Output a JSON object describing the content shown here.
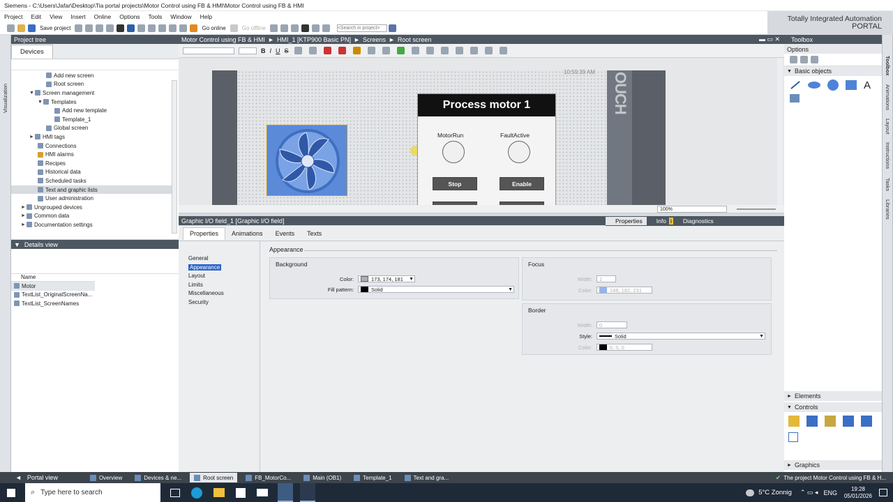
{
  "window": {
    "title": "Siemens - C:\\Users\\Jafar\\Desktop\\Tia portal projects\\Motor Control using FB & HMI\\Motor Control using FB & HMI",
    "brand_line1": "Totally Integrated Automation",
    "brand_line2": "PORTAL"
  },
  "menu": [
    "Project",
    "Edit",
    "View",
    "Insert",
    "Online",
    "Options",
    "Tools",
    "Window",
    "Help"
  ],
  "toolbar": {
    "save_label": "Save project",
    "go_online_label": "Go online",
    "go_offline_label": "Go offline",
    "search_placeholder": "<Search in project>"
  },
  "project_tree": {
    "header": "Project tree",
    "tab_devices": "Devices",
    "side_tab": "Visualization",
    "items": [
      {
        "label": "Add new screen",
        "indent": 4,
        "arrow": ""
      },
      {
        "label": "Root screen",
        "indent": 4,
        "arrow": ""
      },
      {
        "label": "Screen management",
        "indent": 3,
        "arrow": "▼"
      },
      {
        "label": "Templates",
        "indent": 4,
        "arrow": "▼"
      },
      {
        "label": "Add new template",
        "indent": 5,
        "arrow": ""
      },
      {
        "label": "Template_1",
        "indent": 5,
        "arrow": ""
      },
      {
        "label": "Global screen",
        "indent": 4,
        "arrow": ""
      },
      {
        "label": "HMI tags",
        "indent": 3,
        "arrow": "►"
      },
      {
        "label": "Connections",
        "indent": 3,
        "arrow": ""
      },
      {
        "label": "HMI alarms",
        "indent": 3,
        "arrow": ""
      },
      {
        "label": "Recipes",
        "indent": 3,
        "arrow": ""
      },
      {
        "label": "Historical data",
        "indent": 3,
        "arrow": ""
      },
      {
        "label": "Scheduled tasks",
        "indent": 3,
        "arrow": ""
      },
      {
        "label": "Text and graphic lists",
        "indent": 3,
        "arrow": ""
      },
      {
        "label": "User administration",
        "indent": 3,
        "arrow": ""
      },
      {
        "label": "Ungrouped devices",
        "indent": 1,
        "arrow": "►"
      },
      {
        "label": "Common data",
        "indent": 1,
        "arrow": "►"
      },
      {
        "label": "Documentation settings",
        "indent": 1,
        "arrow": "►"
      }
    ]
  },
  "details_view": {
    "header": "Details view",
    "col_name": "Name",
    "rows": [
      "Motor",
      "TextList_OriginalScreenNa...",
      "TextList_ScreenNames"
    ]
  },
  "breadcrumb": [
    "Motor Control using FB & HMI",
    "HMI_1 [KTP900 Basic PN]",
    "Screens",
    "Root screen"
  ],
  "editor": {
    "zoom": "100%",
    "hmi_title": "Process motor 1",
    "lamp1_label": "MotorRun",
    "lamp2_label": "FaultActive",
    "btn_stop": "Stop",
    "btn_enable": "Enable",
    "bezel_text": "OUCH",
    "clock_text": "10:59:39 AM"
  },
  "inspector": {
    "object_title": "Graphic I/O field_1 [Graphic I/O field]",
    "tabs_right": {
      "properties": "Properties",
      "info": "Info",
      "diagnostics": "Diagnostics"
    },
    "tabs": [
      "Properties",
      "Animations",
      "Events",
      "Texts"
    ],
    "nav": [
      "General",
      "Appearance",
      "Layout",
      "Limits",
      "Miscellaneous",
      "Security"
    ],
    "section_title": "Appearance",
    "background": {
      "title": "Background",
      "color_label": "Color:",
      "color_value": "173, 174, 181",
      "fill_label": "Fill pattern:",
      "fill_value": "Solid"
    },
    "focus": {
      "title": "Focus",
      "width_label": "Width:",
      "width_value": "1",
      "color_label": "Color:",
      "color_value": "148, 182, 231"
    },
    "border": {
      "title": "Border",
      "width_label": "Width:",
      "width_value": "0",
      "style_label": "Style:",
      "style_value": "Solid",
      "color_label": "Color:",
      "color_value": "0, 0, 0"
    }
  },
  "toolbox": {
    "header": "Toolbox",
    "options": "Options",
    "basic_objects": "Basic objects",
    "elements": "Elements",
    "controls": "Controls",
    "graphics": "Graphics",
    "side_tabs": [
      "Toolbox",
      "Animations",
      "Layout",
      "Instructions",
      "Tasks",
      "Libraries"
    ]
  },
  "statusbar": {
    "portal_view": "Portal view",
    "tabs": [
      "Overview",
      "Devices & ne...",
      "Root screen",
      "FB_MotorCo...",
      "Main (OB1)",
      "Template_1",
      "Text and gra..."
    ],
    "message": "The project Motor Control using FB & H..."
  },
  "taskbar": {
    "search_placeholder": "Type here to search",
    "weather": "5°C  Zonnig",
    "lang": "ENG",
    "time": "19:28",
    "date": "05/01/2026"
  },
  "colors": {
    "panel_header": "#4d5761",
    "selection": "#2a63c8",
    "hmi_title_bg": "#111111",
    "fan_blue": "#5b8ad8"
  }
}
